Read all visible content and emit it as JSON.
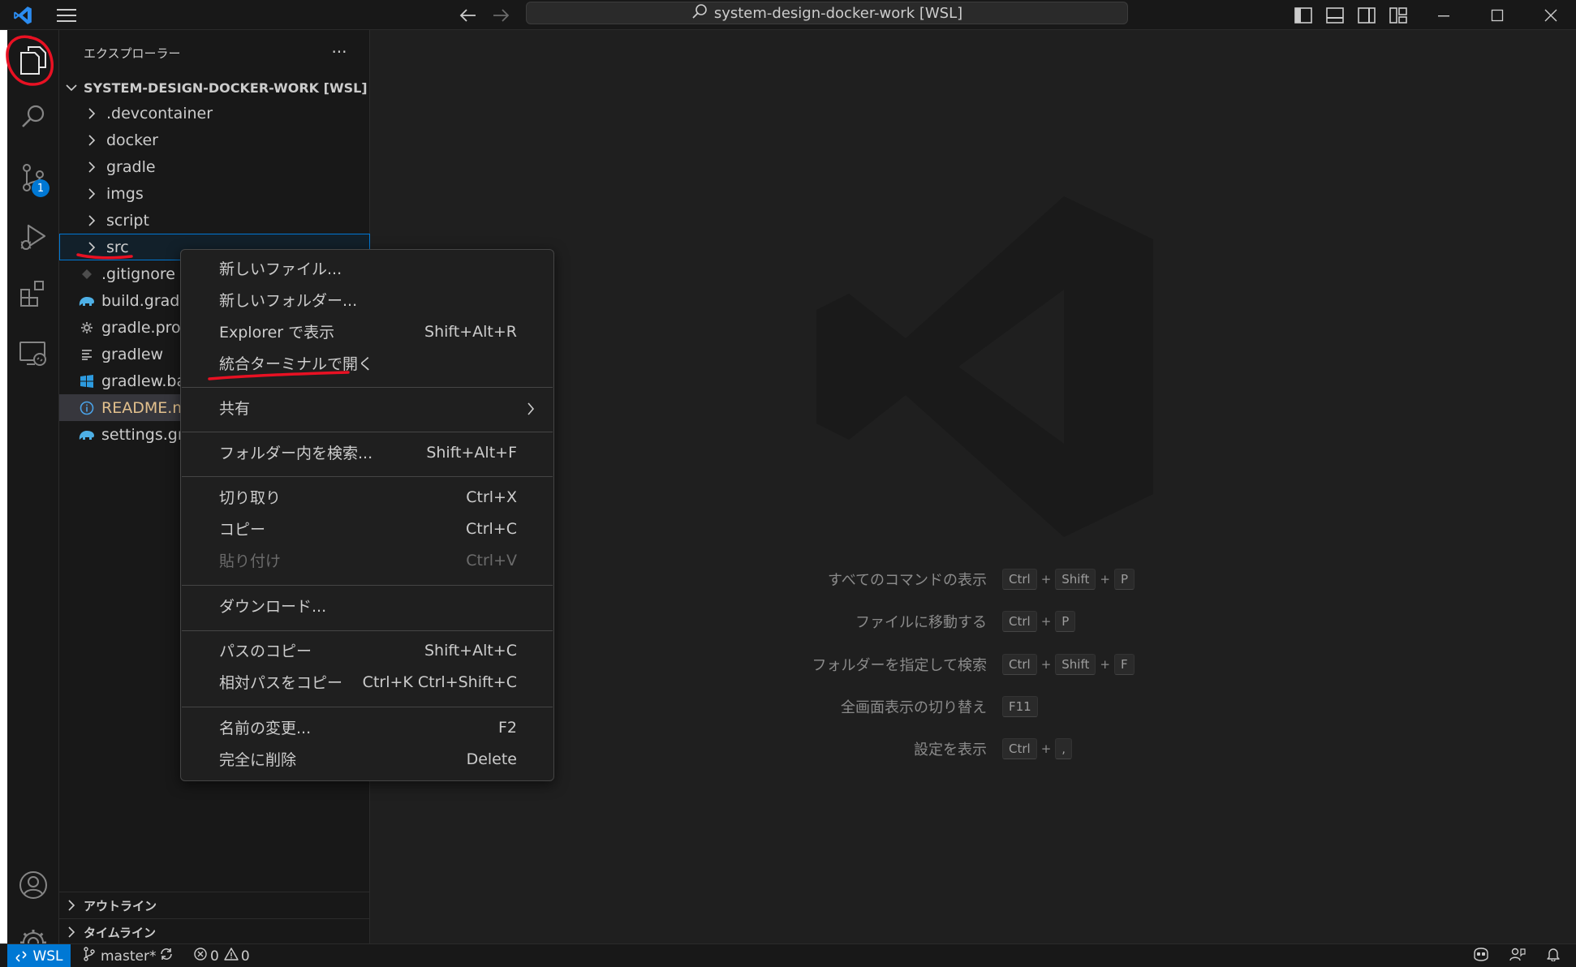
{
  "titlebar": {
    "search_text": "system-design-docker-work [WSL]"
  },
  "activity_bar": {
    "scm_badge": "1"
  },
  "sidebar": {
    "title": "エクスプローラー",
    "more": "···",
    "workspace_title": "SYSTEM-DESIGN-DOCKER-WORK [WSL]",
    "items": [
      {
        "label": ".devcontainer"
      },
      {
        "label": "docker"
      },
      {
        "label": "gradle"
      },
      {
        "label": "imgs"
      },
      {
        "label": "script"
      },
      {
        "label": "src"
      },
      {
        "label": ".gitignore"
      },
      {
        "label": "build.gradle"
      },
      {
        "label": "gradle.properties"
      },
      {
        "label": "gradlew"
      },
      {
        "label": "gradlew.bat"
      },
      {
        "label": "README.md"
      },
      {
        "label": "settings.gradle"
      }
    ],
    "outline_label": "アウトライン",
    "timeline_label": "タイムライン"
  },
  "context_menu": {
    "items": [
      {
        "label": "新しいファイル...",
        "shortcut": ""
      },
      {
        "label": "新しいフォルダー...",
        "shortcut": ""
      },
      {
        "label": "Explorer で表示",
        "shortcut": "Shift+Alt+R"
      },
      {
        "label": "統合ターミナルで開く",
        "shortcut": ""
      },
      {
        "label": "共有",
        "shortcut": ""
      },
      {
        "label": "フォルダー内を検索...",
        "shortcut": "Shift+Alt+F"
      },
      {
        "label": "切り取り",
        "shortcut": "Ctrl+X"
      },
      {
        "label": "コピー",
        "shortcut": "Ctrl+C"
      },
      {
        "label": "貼り付け",
        "shortcut": "Ctrl+V"
      },
      {
        "label": "ダウンロード...",
        "shortcut": ""
      },
      {
        "label": "パスのコピー",
        "shortcut": "Shift+Alt+C"
      },
      {
        "label": "相対パスをコピー",
        "shortcut": "Ctrl+K Ctrl+Shift+C"
      },
      {
        "label": "名前の変更...",
        "shortcut": "F2"
      },
      {
        "label": "完全に削除",
        "shortcut": "Delete"
      }
    ]
  },
  "editor": {
    "shortcuts": [
      {
        "label": "すべてのコマンドの表示",
        "keys": [
          "Ctrl",
          "Shift",
          "P"
        ]
      },
      {
        "label": "ファイルに移動する",
        "keys": [
          "Ctrl",
          "P"
        ]
      },
      {
        "label": "フォルダーを指定して検索",
        "keys": [
          "Ctrl",
          "Shift",
          "F"
        ]
      },
      {
        "label": "全画面表示の切り替え",
        "keys": [
          "F11"
        ]
      },
      {
        "label": "設定を表示",
        "keys": [
          "Ctrl",
          ","
        ]
      }
    ],
    "plus": "+"
  },
  "statusbar": {
    "remote": "WSL",
    "branch": "master*",
    "errors": "0",
    "warnings": "0"
  },
  "colors": {
    "accent": "#0078d4",
    "annotation": "#e81123",
    "modified": "#e2c08d"
  }
}
